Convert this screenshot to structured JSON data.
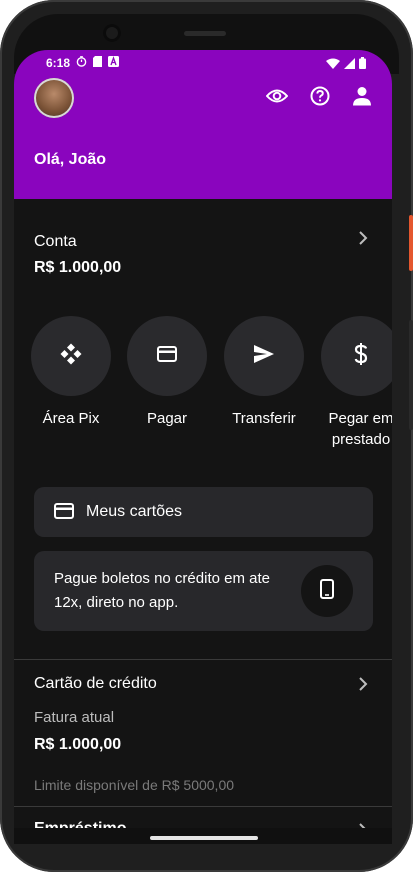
{
  "status_bar": {
    "time": "6:18"
  },
  "header": {
    "greeting": "Olá, João",
    "icons": [
      "eye-icon",
      "help-icon",
      "person-icon"
    ]
  },
  "account": {
    "title": "Conta",
    "balance": "R$ 1.000,00"
  },
  "actions": [
    {
      "label": "Área Pix",
      "icon": "pix-icon"
    },
    {
      "label": "Pagar",
      "icon": "card-icon"
    },
    {
      "label": "Transferir",
      "icon": "send-icon"
    },
    {
      "label_line1": "Pegar em",
      "label_line2": "prestado",
      "icon": "dollar-icon"
    }
  ],
  "cards_button": {
    "label": "Meus cartões",
    "icon": "credit-card-icon"
  },
  "promo": {
    "text": "Pague boletos no crédito em ate 12x, direto no app.",
    "icon": "phone-icon"
  },
  "credit_card": {
    "title": "Cartão de crédito",
    "subtitle": "Fatura atual",
    "amount": "R$ 1.000,00",
    "limit": "Limite disponível de R$ 5000,00"
  },
  "loans": {
    "title": "Empréstimo"
  },
  "colors": {
    "brand_purple": "#8a05be",
    "background": "#141414",
    "surface": "#28282b"
  }
}
